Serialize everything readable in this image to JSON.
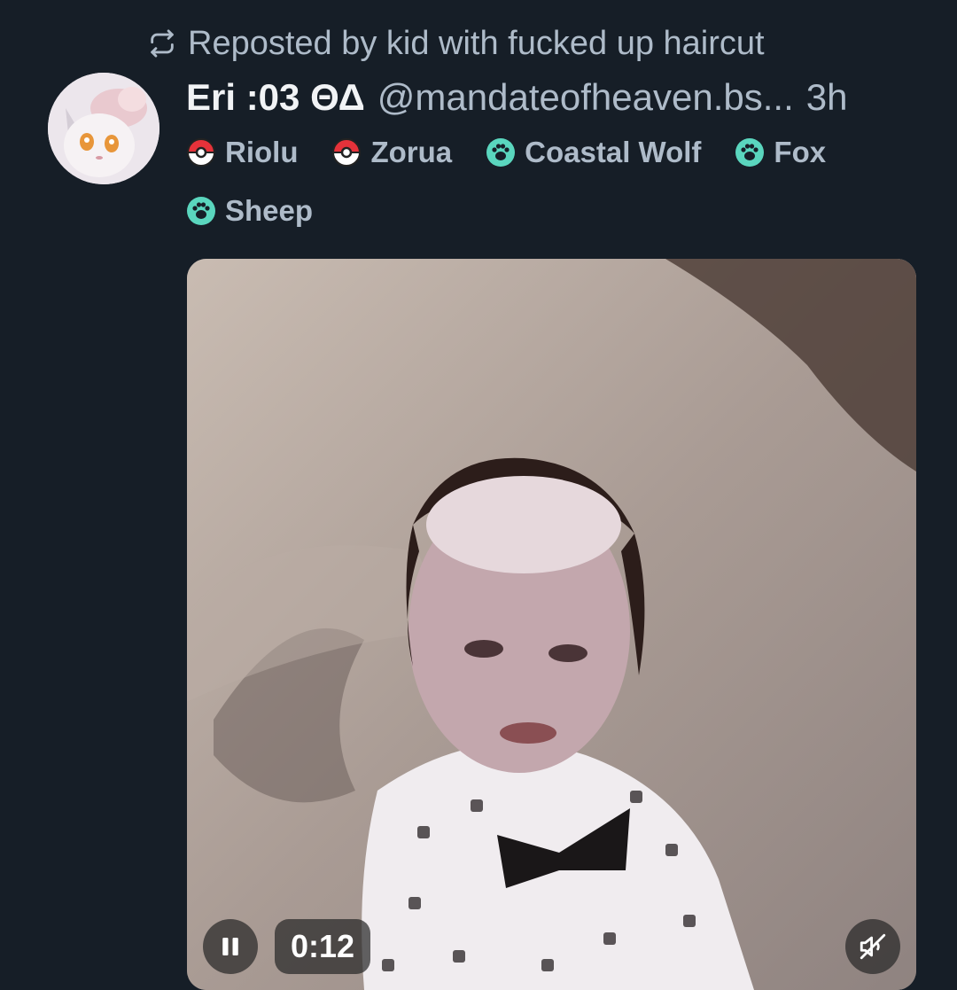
{
  "repost": {
    "label": "Reposted by kid with fucked up haircut",
    "icon": "repost-icon"
  },
  "post": {
    "display_name": "Eri :03 ΘΔ",
    "handle": "@mandateofheaven.bs...",
    "time": "3h",
    "avatar": "avatar-image"
  },
  "tags": [
    {
      "label": "Riolu",
      "icon": "pokeball-icon"
    },
    {
      "label": "Zorua",
      "icon": "pokeball-icon"
    },
    {
      "label": "Coastal Wolf",
      "icon": "paw-icon"
    },
    {
      "label": "Fox",
      "icon": "paw-icon"
    },
    {
      "label": "Sheep",
      "icon": "paw-icon"
    }
  ],
  "video": {
    "time": "0:12",
    "pause_icon": "pause-icon",
    "mute_icon": "muted-speaker-icon"
  },
  "colors": {
    "background": "#161e27",
    "muted_text": "#aebbc9",
    "paw_accent": "#5ad6be",
    "pokeball_red": "#e5323a"
  }
}
